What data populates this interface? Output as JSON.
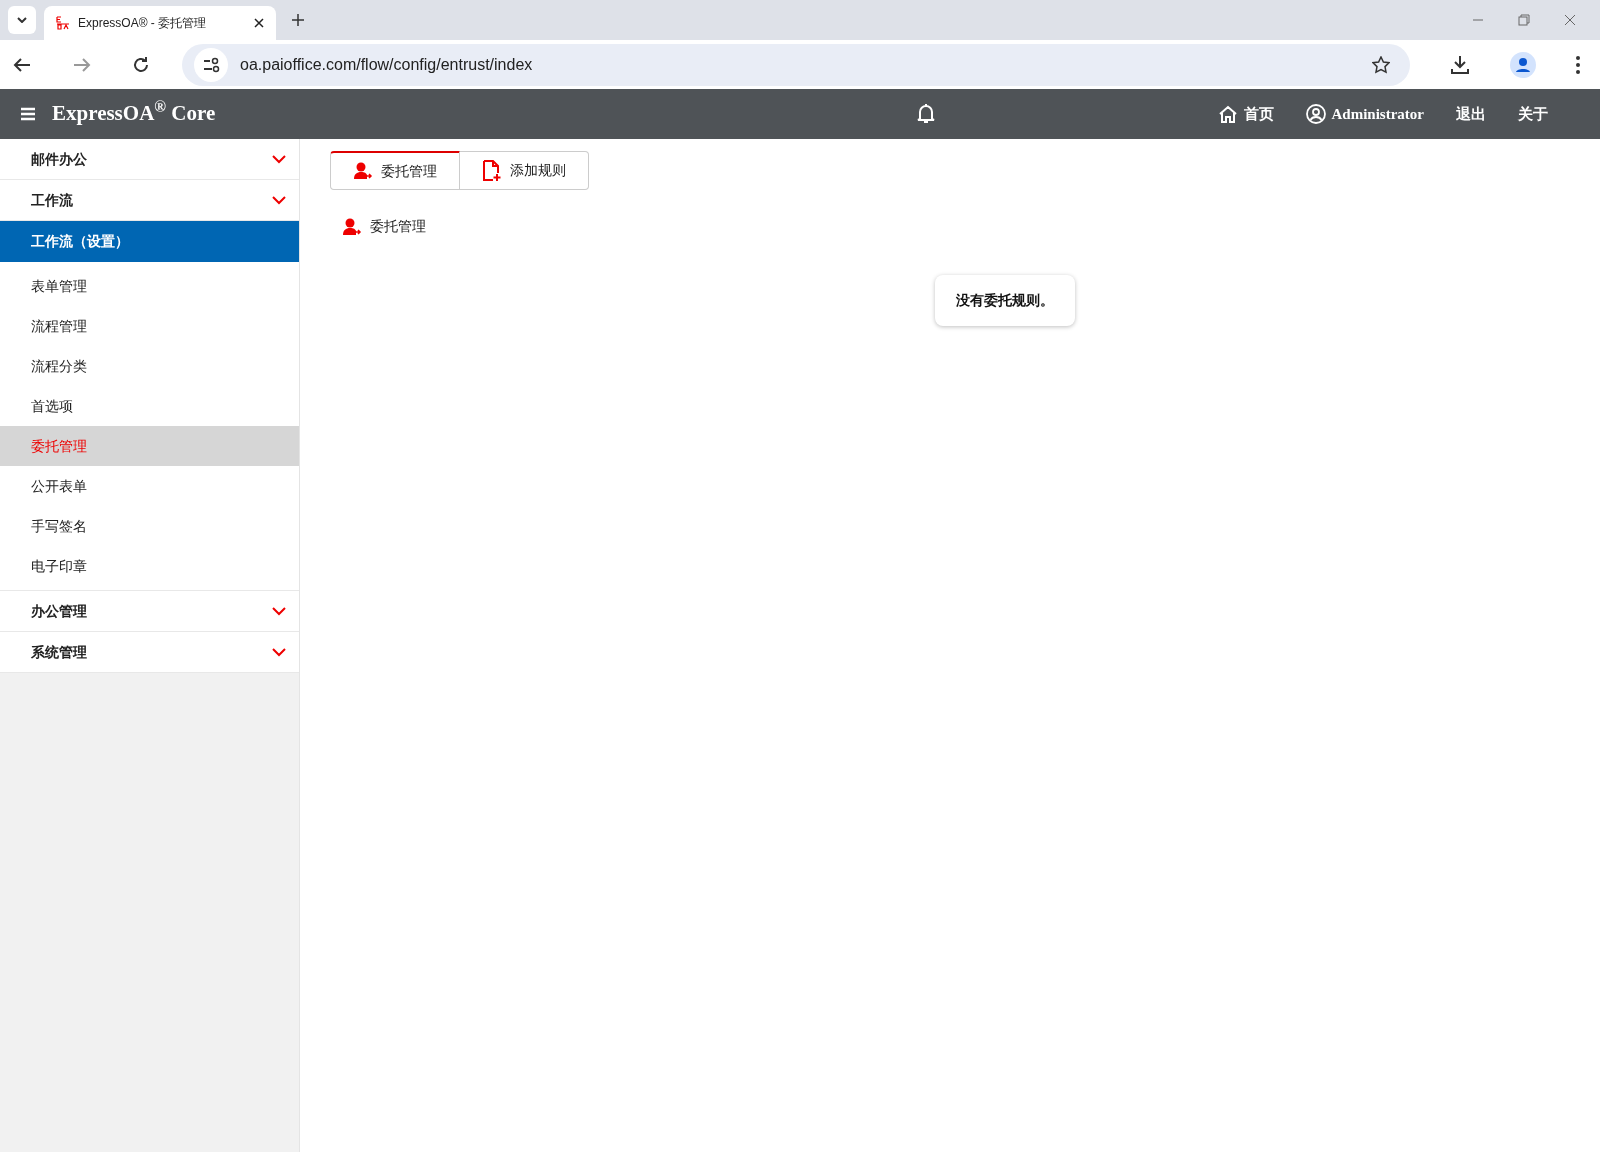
{
  "browser": {
    "tab_title": "ExpressOA® - 委托管理",
    "address": "oa.paioffice.com/flow/config/entrust/index"
  },
  "header": {
    "brand": "ExpressOA",
    "brand_mark": "®",
    "brand_suffix": " Core",
    "nav": [
      {
        "kind": "home",
        "label": "首页"
      },
      {
        "kind": "user",
        "label": "Administrator"
      },
      {
        "kind": "plain",
        "label": "退出"
      },
      {
        "kind": "plain",
        "label": "关于"
      }
    ]
  },
  "sidebar": [
    {
      "label": "邮件办公",
      "expanded": false
    },
    {
      "label": "工作流",
      "expanded": false
    },
    {
      "label": "工作流（设置）",
      "expanded": true,
      "children": [
        {
          "label": "表单管理",
          "selected": false
        },
        {
          "label": "流程管理",
          "selected": false
        },
        {
          "label": "流程分类",
          "selected": false
        },
        {
          "label": "首选项",
          "selected": false
        },
        {
          "label": "委托管理",
          "selected": true
        },
        {
          "label": "公开表单",
          "selected": false
        },
        {
          "label": "手写签名",
          "selected": false
        },
        {
          "label": "电子印章",
          "selected": false
        }
      ]
    },
    {
      "label": "办公管理",
      "expanded": false
    },
    {
      "label": "系统管理",
      "expanded": false
    }
  ],
  "tabs": [
    {
      "kind": "user",
      "label": "委托管理",
      "selected": true
    },
    {
      "kind": "add",
      "label": "添加规则",
      "selected": false
    }
  ],
  "section_title": "委托管理",
  "empty_message": "没有委托规则。"
}
